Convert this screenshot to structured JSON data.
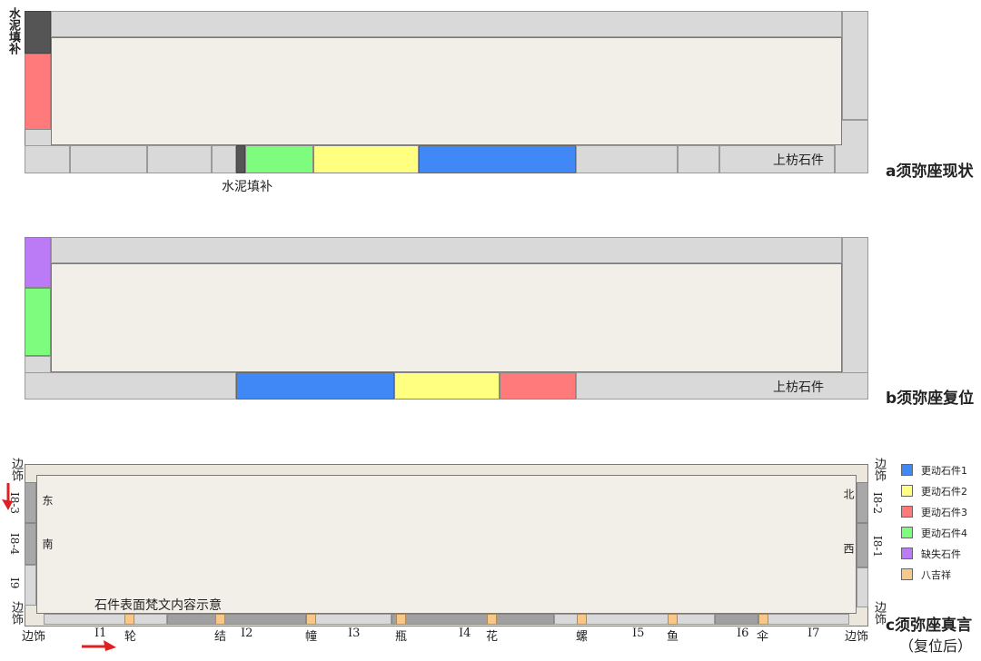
{
  "colors": {
    "stone1": "#3f88f5",
    "stone2": "#ffff80",
    "stone3": "#ff7b7b",
    "stone4": "#7dfc7d",
    "missing": "#bb7bf7",
    "bajixiang": "#f8c88a",
    "cement": "#555555"
  },
  "panel_a": {
    "title": "a须弥座现状",
    "cement_label_left": "水泥填补",
    "cement_label_bottom": "水泥填补",
    "upper_label": "上枋石件"
  },
  "panel_b": {
    "title": "b须弥座复位",
    "upper_label": "上枋石件"
  },
  "panel_c": {
    "title": "c须弥座真言",
    "subtitle": "（复位后）",
    "caption": "石件表面梵文内容示意",
    "left_side": [
      "边饰",
      "I8-3",
      "I8-4",
      "I9",
      "边饰"
    ],
    "right_side": [
      "边饰",
      "I8-2",
      "I8-1",
      "边饰"
    ],
    "inner_left": [
      "东",
      "南"
    ],
    "inner_right": [
      "北",
      "西"
    ],
    "bottom_labels": [
      "边饰",
      "I1",
      "轮",
      "结",
      "I2",
      "幢",
      "I3",
      "瓶",
      "I4",
      "花",
      "螺",
      "I5",
      "鱼",
      "I6",
      "伞",
      "I7",
      "边饰"
    ]
  },
  "legend": [
    {
      "label": "更动石件1",
      "color": "#3f88f5"
    },
    {
      "label": "更动石件2",
      "color": "#ffff80"
    },
    {
      "label": "更动石件3",
      "color": "#ff7b7b"
    },
    {
      "label": "更动石件4",
      "color": "#7dfc7d"
    },
    {
      "label": "缺失石件",
      "color": "#bb7bf7"
    },
    {
      "label": "八吉祥",
      "color": "#f8c88a"
    }
  ]
}
